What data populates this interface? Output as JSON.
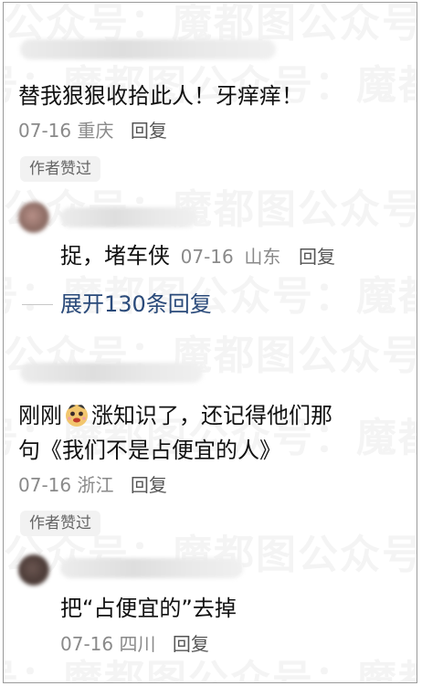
{
  "watermark": {
    "text": "公众号：魔都图"
  },
  "comments": [
    {
      "text": "替我狠狠收拾此人！牙痒痒！",
      "date": "07-16",
      "location": "重庆",
      "reply_label": "回复",
      "badge": "作者赞过"
    },
    {
      "text_before_emoji": "刚刚",
      "emoji": "face-emoji",
      "text_after_emoji": "涨知识了，还记得他们那",
      "text_line2": "句《我们不是占便宜的人》",
      "date": "07-16",
      "location": "浙江",
      "reply_label": "回复",
      "badge": "作者赞过"
    }
  ],
  "replies": [
    {
      "text": "捉，堵车侠",
      "date": "07-16",
      "location": "山东",
      "reply_label": "回复"
    },
    {
      "text": "把“占便宜的”去掉",
      "date": "07-16",
      "location": "四川",
      "reply_label": "回复"
    }
  ],
  "expand": {
    "label": "展开130条回复"
  },
  "colors": {
    "link": "#2a4a7a",
    "meta": "#8a8a8a",
    "badge_bg": "#f2f2f2"
  }
}
